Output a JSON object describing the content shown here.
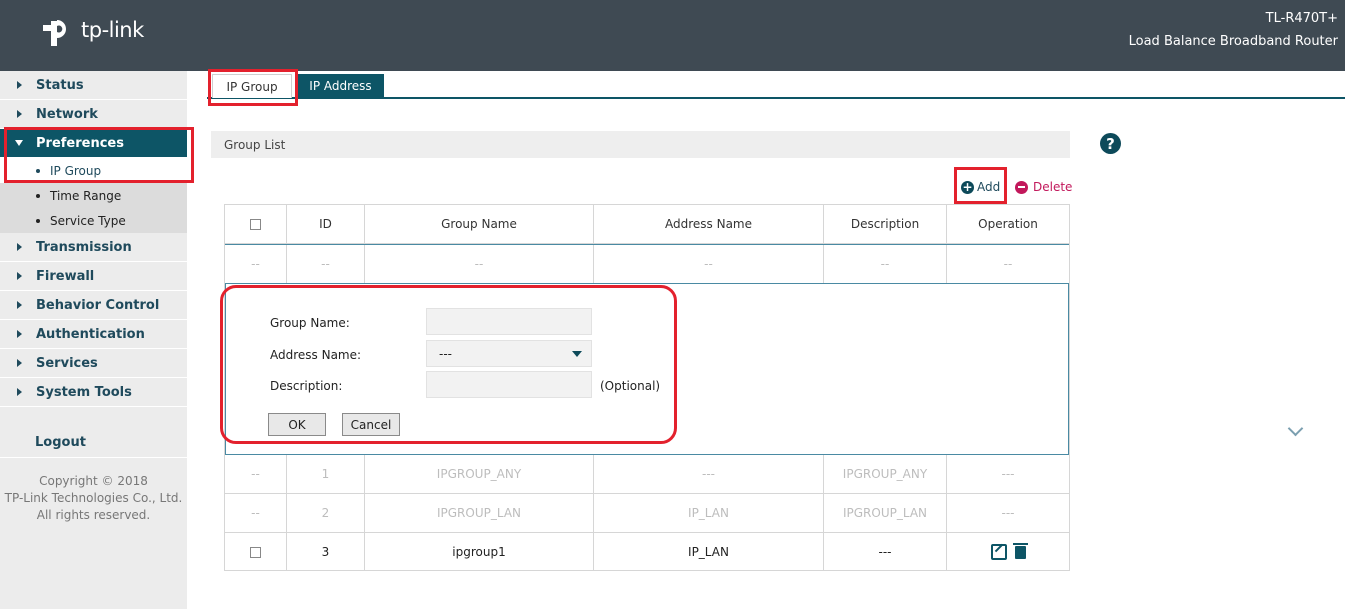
{
  "header": {
    "logo_text": "tp-link",
    "model": "TL-R470T+",
    "description": "Load Balance Broadband Router"
  },
  "sidebar": {
    "items": [
      {
        "label": "Status"
      },
      {
        "label": "Network"
      },
      {
        "label": "Preferences",
        "active": true
      },
      {
        "label": "Transmission"
      },
      {
        "label": "Firewall"
      },
      {
        "label": "Behavior Control"
      },
      {
        "label": "Authentication"
      },
      {
        "label": "Services"
      },
      {
        "label": "System Tools"
      }
    ],
    "sub_items": [
      {
        "label": "IP Group",
        "selected": true
      },
      {
        "label": "Time Range"
      },
      {
        "label": "Service Type"
      }
    ],
    "logout": "Logout",
    "copyright": [
      "Copyright © 2018",
      "TP-Link Technologies Co., Ltd.",
      "All rights reserved."
    ]
  },
  "tabs": [
    {
      "label": "IP Group",
      "active": true
    },
    {
      "label": "IP Address"
    }
  ],
  "group_list": {
    "title": "Group List",
    "help_icon": "?",
    "add_label": "Add",
    "delete_label": "Delete"
  },
  "table": {
    "columns": [
      "ID",
      "Group Name",
      "Address Name",
      "Description",
      "Operation"
    ],
    "new_row": [
      "--",
      "--",
      "--",
      "--",
      "--",
      "--"
    ],
    "rows": [
      {
        "check": "--",
        "id": "1",
        "group": "IPGROUP_ANY",
        "address": "---",
        "desc": "IPGROUP_ANY",
        "op": "---",
        "dim": true
      },
      {
        "check": "--",
        "id": "2",
        "group": "IPGROUP_LAN",
        "address": "IP_LAN",
        "desc": "IPGROUP_LAN",
        "op": "---",
        "dim": true
      },
      {
        "check": "",
        "id": "3",
        "group": "ipgroup1",
        "address": "IP_LAN",
        "desc": "---",
        "op": "",
        "dim": false
      }
    ]
  },
  "form": {
    "group_name_label": "Group Name:",
    "group_name_value": "",
    "address_name_label": "Address Name:",
    "address_name_value": "---",
    "description_label": "Description:",
    "description_value": "",
    "optional": "(Optional)",
    "ok": "OK",
    "cancel": "Cancel"
  },
  "colors": {
    "header_bg": "#3f4a53",
    "accent": "#0d5566",
    "highlight": "#e3212d",
    "delete": "#c2185b"
  }
}
